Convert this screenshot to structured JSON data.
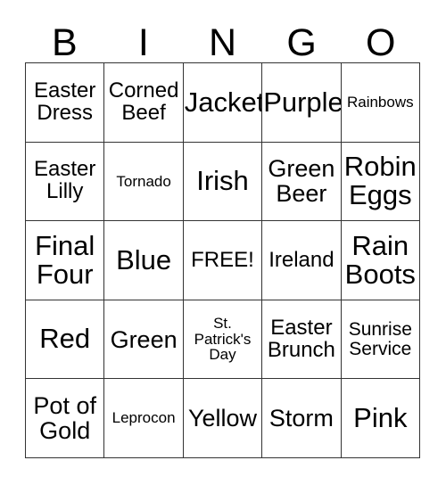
{
  "card": {
    "header": {
      "letters": [
        "B",
        "I",
        "N",
        "G",
        "O"
      ]
    },
    "grid": {
      "rows": 5,
      "columns": 5,
      "free_space_label": "FREE!",
      "cells": [
        [
          {
            "label": "Easter Dress",
            "size": "md"
          },
          {
            "label": "Corned Beef",
            "size": "md"
          },
          {
            "label": "Jacket",
            "size": "xl"
          },
          {
            "label": "Purple",
            "size": "xl"
          },
          {
            "label": "Rainbows",
            "size": "xs"
          }
        ],
        [
          {
            "label": "Easter Lilly",
            "size": "md"
          },
          {
            "label": "Tornado",
            "size": "xs"
          },
          {
            "label": "Irish",
            "size": "xl"
          },
          {
            "label": "Green Beer",
            "size": "lg"
          },
          {
            "label": "Robin Eggs",
            "size": "xl"
          }
        ],
        [
          {
            "label": "Final Four",
            "size": "xl"
          },
          {
            "label": "Blue",
            "size": "xl"
          },
          {
            "label": "FREE!",
            "size": "md"
          },
          {
            "label": "Ireland",
            "size": "md"
          },
          {
            "label": "Rain Boots",
            "size": "xl"
          }
        ],
        [
          {
            "label": "Red",
            "size": "xl"
          },
          {
            "label": "Green",
            "size": "lg"
          },
          {
            "label": "St. Patrick's Day",
            "size": "xs"
          },
          {
            "label": "Easter Brunch",
            "size": "md"
          },
          {
            "label": "Sunrise Service",
            "size": "sm"
          }
        ],
        [
          {
            "label": "Pot of Gold",
            "size": "lg"
          },
          {
            "label": "Leprocon",
            "size": "xs"
          },
          {
            "label": "Yellow",
            "size": "lg"
          },
          {
            "label": "Storm",
            "size": "lg"
          },
          {
            "label": "Pink",
            "size": "xl"
          }
        ]
      ]
    },
    "colors": {
      "background": "#ffffff",
      "text": "#000000",
      "grid_line": "#333333"
    }
  }
}
